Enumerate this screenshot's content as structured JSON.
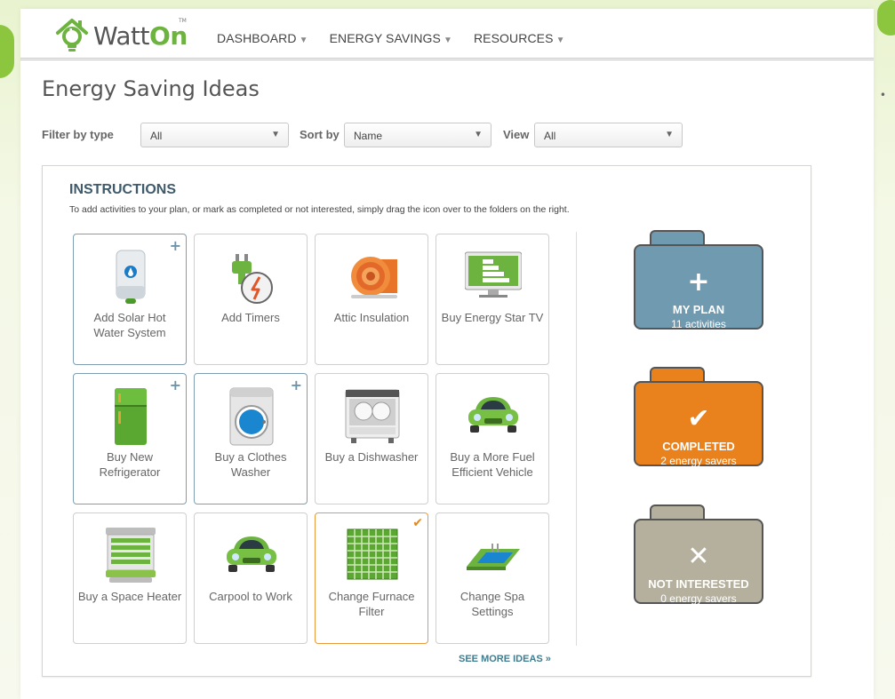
{
  "brand": {
    "name_part1": "Watt",
    "name_part2": "On",
    "tm": "TM"
  },
  "nav": [
    {
      "label": "DASHBOARD",
      "caret": "▼"
    },
    {
      "label": "ENERGY SAVINGS",
      "caret": "▼"
    },
    {
      "label": "RESOURCES",
      "caret": "▼"
    }
  ],
  "page": {
    "title": "Energy Saving Ideas"
  },
  "filters": {
    "type_label": "Filter by type",
    "type_value": "All",
    "sort_label": "Sort by",
    "sort_value": "Name",
    "view_label": "View",
    "view_value": "All",
    "caret": "▼"
  },
  "instructions": {
    "title": "INSTRUCTIONS",
    "text": "To add activities to your plan, or mark as completed or not interested, simply drag the icon over to the folders on the right."
  },
  "ideas": [
    {
      "label": "Add Solar Hot Water System",
      "status": "plan",
      "badge": "+"
    },
    {
      "label": "Add Timers",
      "status": "none",
      "badge": ""
    },
    {
      "label": "Attic Insulation",
      "status": "none",
      "badge": ""
    },
    {
      "label": "Buy Energy Star TV",
      "status": "none",
      "badge": ""
    },
    {
      "label": "Buy New Refrigerator",
      "status": "plan",
      "badge": "+"
    },
    {
      "label": "Buy a Clothes Washer",
      "status": "plan",
      "badge": "+"
    },
    {
      "label": "Buy a Dishwasher",
      "status": "none",
      "badge": ""
    },
    {
      "label": "Buy a More Fuel Efficient Vehicle",
      "status": "none",
      "badge": ""
    },
    {
      "label": "Buy a Space Heater",
      "status": "none",
      "badge": ""
    },
    {
      "label": "Carpool to Work",
      "status": "none",
      "badge": ""
    },
    {
      "label": "Change Furnace Filter",
      "status": "done",
      "badge": "✔"
    },
    {
      "label": "Change Spa Settings",
      "status": "none",
      "badge": ""
    }
  ],
  "folders": {
    "plan": {
      "title": "MY PLAN",
      "subtitle": "11 activities",
      "symbol": "+",
      "color": "#6f9ab0",
      "tab_color": "#6f9ab0"
    },
    "completed": {
      "title": "COMPLETED",
      "subtitle": "2 energy savers",
      "symbol": "✔",
      "color": "#e9821c",
      "tab_color": "#e9821c"
    },
    "not_interested": {
      "title": "NOT INTERESTED",
      "subtitle": "0 energy savers",
      "symbol": "✕",
      "color": "#b5b09d",
      "tab_color": "#b5b09d"
    }
  },
  "see_more": "SEE MORE IDEAS »",
  "icons": {
    "solar": "water-heater-icon",
    "timer": "timer-plug-icon",
    "attic": "insulation-roll-icon",
    "tv": "energy-star-tv-icon",
    "fridge": "refrigerator-icon",
    "washer": "washing-machine-icon",
    "dish": "dishwasher-icon",
    "car": "car-icon",
    "heater": "space-heater-icon",
    "carpool": "carpool-car-icon",
    "filter": "furnace-filter-icon",
    "spa": "spa-pool-icon"
  }
}
